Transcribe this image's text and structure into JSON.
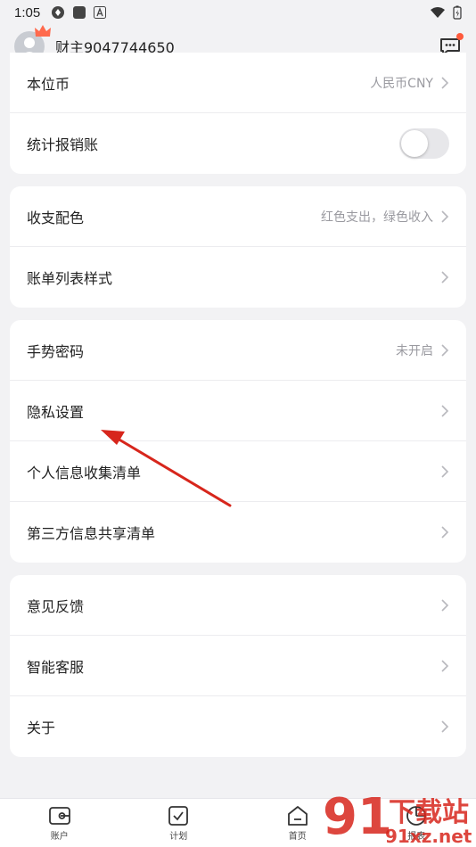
{
  "status": {
    "time": "1:05"
  },
  "header": {
    "username": "财主9047744650"
  },
  "groups": [
    {
      "rows": [
        {
          "label": "本位币",
          "value": "人民币CNY",
          "control": "chevron"
        },
        {
          "label": "统计报销账",
          "value": "",
          "control": "toggle",
          "toggle_on": false
        }
      ]
    },
    {
      "rows": [
        {
          "label": "收支配色",
          "value": "红色支出，绿色收入",
          "control": "chevron"
        },
        {
          "label": "账单列表样式",
          "value": "",
          "control": "chevron"
        }
      ]
    },
    {
      "rows": [
        {
          "label": "手势密码",
          "value": "未开启",
          "control": "chevron"
        },
        {
          "label": "隐私设置",
          "value": "",
          "control": "chevron"
        },
        {
          "label": "个人信息收集清单",
          "value": "",
          "control": "chevron"
        },
        {
          "label": "第三方信息共享清单",
          "value": "",
          "control": "chevron"
        }
      ]
    },
    {
      "rows": [
        {
          "label": "意见反馈",
          "value": "",
          "control": "chevron"
        },
        {
          "label": "智能客服",
          "value": "",
          "control": "chevron"
        },
        {
          "label": "关于",
          "value": "",
          "control": "chevron"
        }
      ]
    }
  ],
  "bottom_nav": [
    {
      "label": "账户",
      "icon": "wallet-icon"
    },
    {
      "label": "计划",
      "icon": "checkbox-icon"
    },
    {
      "label": "首页",
      "icon": "home-icon"
    },
    {
      "label": "报表",
      "icon": "report-icon"
    }
  ],
  "watermark": {
    "text_main": "下载站",
    "text_url": "91xz.net"
  },
  "colors": {
    "accent_red": "#d7261c",
    "notification_dot": "#ff5a3c",
    "value_gray": "#9a9aa0"
  }
}
